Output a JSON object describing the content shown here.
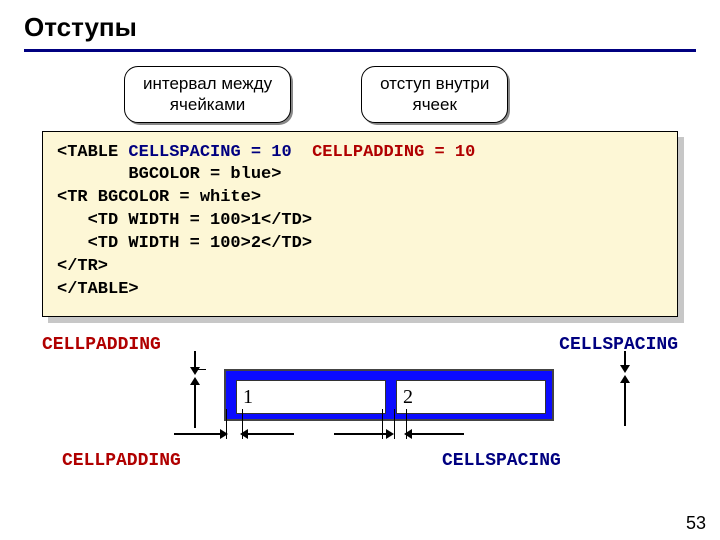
{
  "title": "Отступы",
  "callouts": {
    "left": "интервал между\nячейками",
    "right": "отступ внутри\nячеек"
  },
  "code": {
    "l1a": "<TABLE ",
    "l1b": "CELLSPACING = 10",
    "l1c": "  ",
    "l1d": "CELLPADDING = 10",
    "l2": "       BGCOLOR = blue>",
    "l3": "<TR BGCOLOR = white>",
    "l4": "   <TD WIDTH = 100>1</TD>",
    "l5": "   <TD WIDTH = 100>2</TD>",
    "l6": "</TR>",
    "l7": "</TABLE>"
  },
  "labels": {
    "cellpadding": "CELLPADDING",
    "cellspacing": "CELLSPACING"
  },
  "cells": {
    "c1": "1",
    "c2": "2"
  },
  "page": "53"
}
